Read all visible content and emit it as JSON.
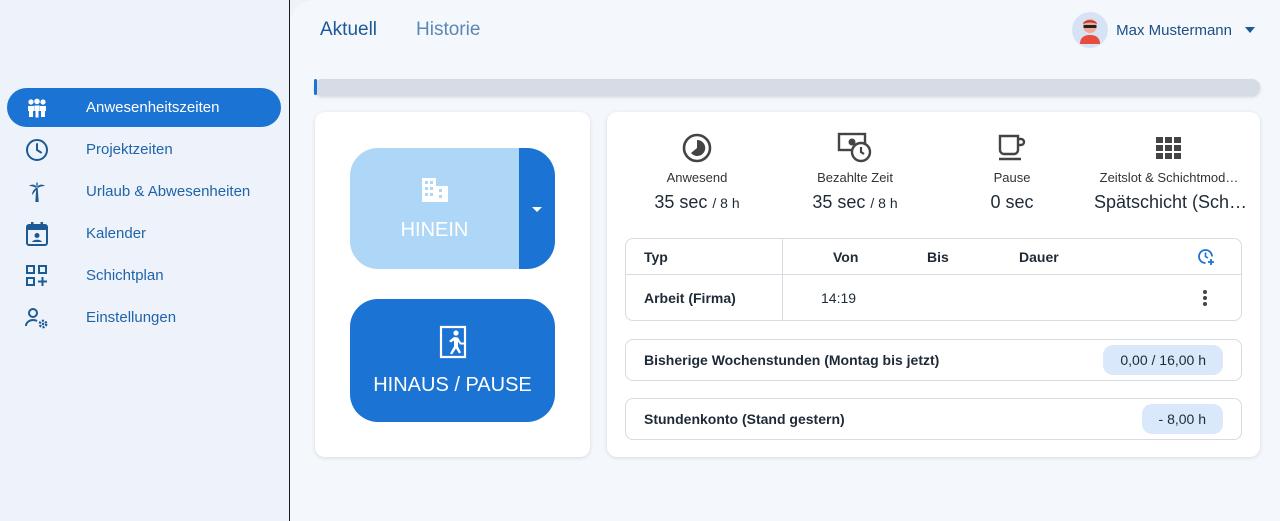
{
  "header": {
    "tabs": [
      {
        "label": "Aktuell"
      },
      {
        "label": "Historie"
      }
    ],
    "user_name": "Max Mustermann"
  },
  "sidebar": {
    "items": [
      {
        "label": "Anwesenheitszeiten",
        "icon": "people-icon"
      },
      {
        "label": "Projektzeiten",
        "icon": "clock-icon"
      },
      {
        "label": "Urlaub & Abwesenheiten",
        "icon": "palm-tree-icon"
      },
      {
        "label": "Kalender",
        "icon": "calendar-icon"
      },
      {
        "label": "Schichtplan",
        "icon": "grid-plus-icon"
      },
      {
        "label": "Einstellungen",
        "icon": "user-settings-icon"
      }
    ]
  },
  "actions": {
    "in_label": "HINEIN",
    "out_label": "HINAUS / PAUSE"
  },
  "stats": {
    "present": {
      "label": "Anwesend",
      "value": "35 sec",
      "target": "/ 8 h"
    },
    "paid": {
      "label": "Bezahlte Zeit",
      "value": "35 sec",
      "target": "/ 8 h"
    },
    "pause": {
      "label": "Pause",
      "value": "0 sec"
    },
    "shift": {
      "label": "Zeitslot & Schichtmod…",
      "value": "Spätschicht (Sch…"
    }
  },
  "table": {
    "headers": {
      "typ": "Typ",
      "von": "Von",
      "bis": "Bis",
      "dauer": "Dauer"
    },
    "rows": [
      {
        "typ": "Arbeit (Firma)",
        "von": "14:19",
        "bis": "",
        "dauer": ""
      }
    ]
  },
  "summary": {
    "week_label": "Bisherige Wochenstunden (Montag bis jetzt)",
    "week_value": "0,00 / 16,00 h",
    "account_label": "Stundenkonto (Stand gestern)",
    "account_value": "- 8,00 h"
  },
  "colors": {
    "accent": "#1b73d3",
    "accent_light": "#aed6f6",
    "background": "#eef3fb"
  }
}
